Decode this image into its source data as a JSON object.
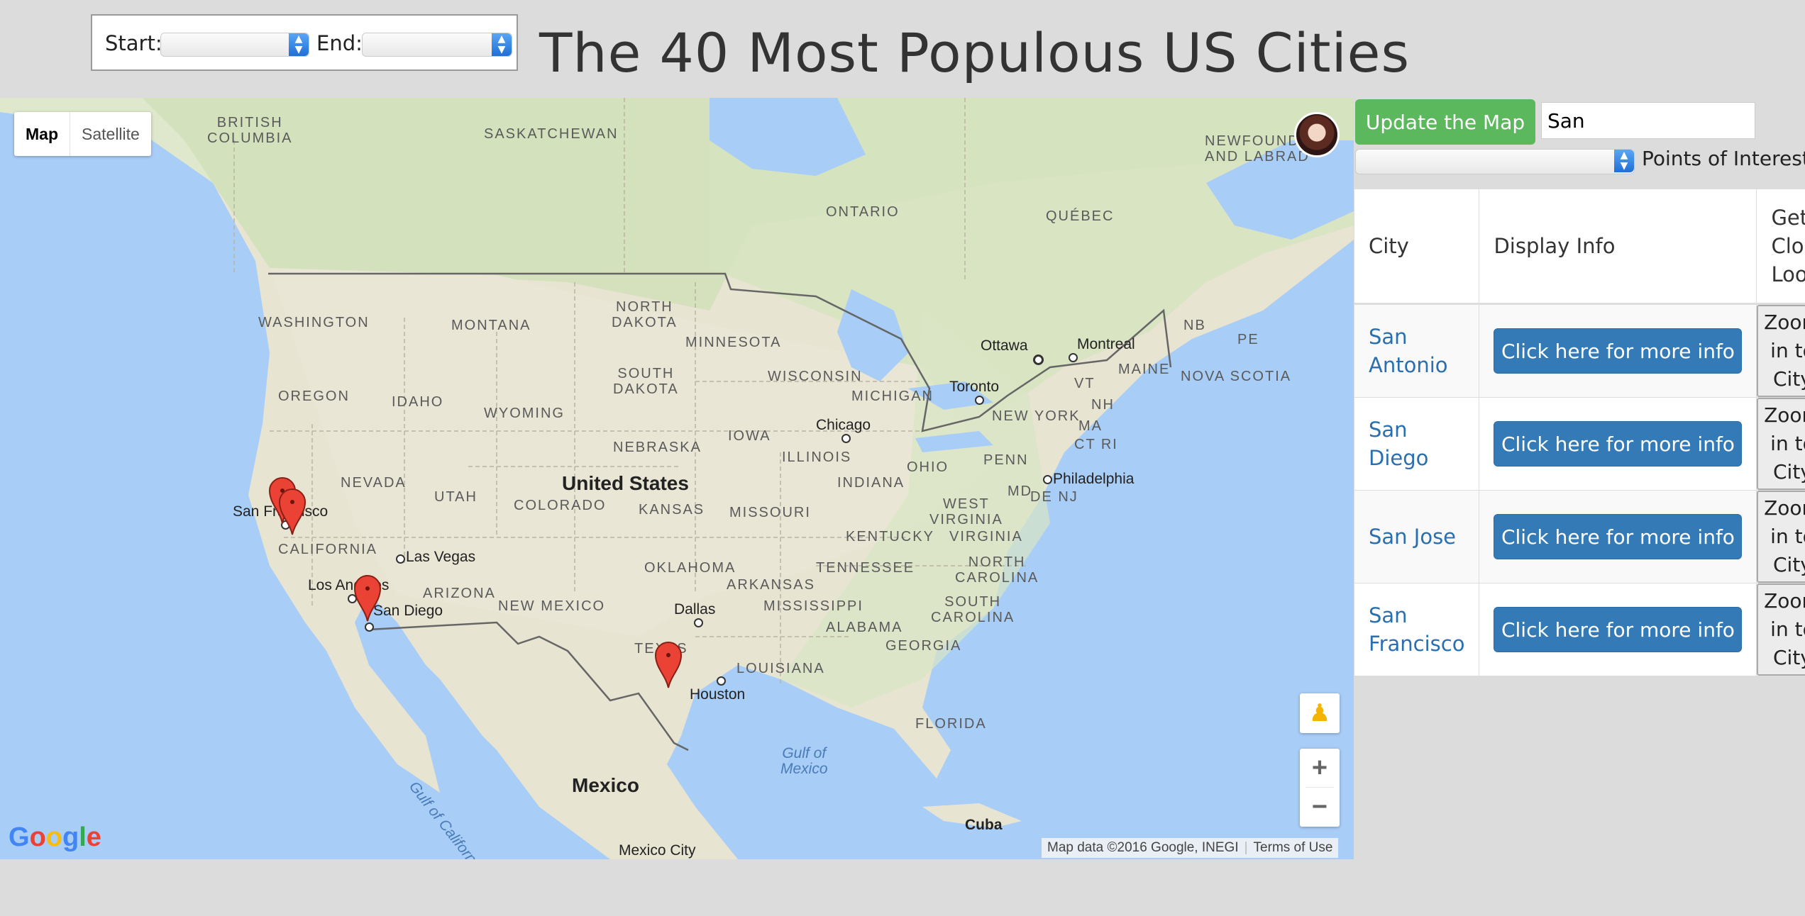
{
  "header": {
    "start_label": "Start:",
    "end_label": "End:",
    "start_value": "",
    "end_value": "",
    "title": "The 40 Most Populous US Cities"
  },
  "map": {
    "type_buttons": [
      "Map",
      "Satellite"
    ],
    "active_type": "Map",
    "logo": "Google",
    "attribution": "Map data ©2016 Google, INEGI",
    "terms": "Terms of Use",
    "zoom_in": "+",
    "zoom_out": "−",
    "labels": {
      "british_columbia": "BRITISH\nCOLUMBIA",
      "saskatchewan": "SASKATCHEWAN",
      "ontario": "ONTARIO",
      "quebec": "QUÉBEC",
      "newfoundland": "NEWFOUND\nAND LABRAD",
      "washington": "WASHINGTON",
      "montana": "MONTANA",
      "north_dakota": "NORTH\nDAKOTA",
      "minnesota": "MINNESOTA",
      "oregon": "OREGON",
      "idaho": "IDAHO",
      "wyoming": "WYOMING",
      "south_dakota": "SOUTH\nDAKOTA",
      "wisconsin": "WISCONSIN",
      "michigan": "MICHIGAN",
      "nevada": "NEVADA",
      "utah": "UTAH",
      "colorado": "COLORADO",
      "nebraska": "NEBRASKA",
      "iowa": "IOWA",
      "illinois": "ILLINOIS",
      "indiana": "INDIANA",
      "ohio": "OHIO",
      "penn": "PENN",
      "new_york": "NEW YORK",
      "california": "CALIFORNIA",
      "arizona": "ARIZONA",
      "new_mexico": "NEW MEXICO",
      "kansas": "KANSAS",
      "missouri": "MISSOURI",
      "kentucky": "KENTUCKY",
      "west_virginia": "WEST\nVIRGINIA",
      "virginia": "VIRGINIA",
      "oklahoma": "OKLAHOMA",
      "tennessee": "TENNESSEE",
      "north_carolina": "NORTH\nCAROLINA",
      "arkansas": "ARKANSAS",
      "mississippi": "MISSISSIPPI",
      "south_carolina": "SOUTH\nCAROLINA",
      "alabama": "ALABAMA",
      "georgia": "GEORGIA",
      "louisiana": "LOUISIANA",
      "texas": "TEXAS",
      "florida": "FLORIDA",
      "maine": "MAINE",
      "nova_scotia": "NOVA SCOTIA",
      "nb": "NB",
      "pe": "PE",
      "vt": "VT",
      "nh": "NH",
      "ma": "MA",
      "ct_ri": "CT RI",
      "md": "MD",
      "de_nj": "DE NJ",
      "united_states": "United States",
      "mexico": "Mexico",
      "cuba": "Cuba",
      "gulf_of_mexico": "Gulf of\nMexico",
      "gulf_of_california": "Gulf of California",
      "ottawa": "Ottawa",
      "montreal": "Montreal",
      "toronto": "Toronto",
      "chicago": "Chicago",
      "philadelphia": "Philadelphia",
      "san_francisco": "San Francisco",
      "las_vegas": "Las Vegas",
      "los_angeles": "Los Angeles",
      "san_diego": "San Diego",
      "dallas": "Dallas",
      "houston": "Houston",
      "mexico_city": "Mexico City"
    }
  },
  "panel": {
    "update_label": "Update the Map",
    "search_value": "San",
    "poi_label": "Points of Interest:",
    "poi_value": ""
  },
  "table": {
    "headers": [
      "City",
      "Display Info",
      "Get A Closer Look"
    ],
    "rows": [
      {
        "city": "San Antonio",
        "info": "Click here for more info",
        "zoom": "Zoom in to City"
      },
      {
        "city": "San Diego",
        "info": "Click here for more info",
        "zoom": "Zoom in to City"
      },
      {
        "city": "San Jose",
        "info": "Click here for more info",
        "zoom": "Zoom in to City"
      },
      {
        "city": "San Francisco",
        "info": "Click here for more info",
        "zoom": "Zoom in to City"
      }
    ]
  },
  "colors": {
    "update_button": "#5cb85c",
    "info_button": "#337ab7",
    "link": "#2a6fb0",
    "marker": "#ea4335",
    "water": "#a8cdf7"
  }
}
